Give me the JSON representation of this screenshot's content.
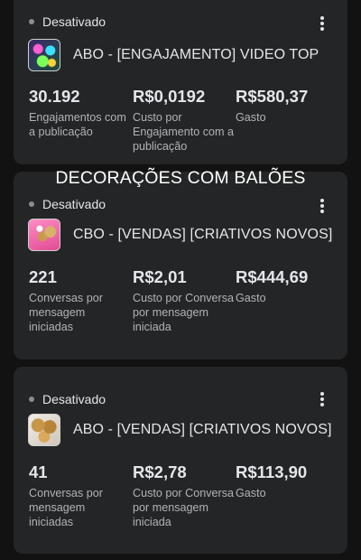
{
  "section_title": "DECORAÇÕES COM BALÕES",
  "cards": [
    {
      "status": "Desativado",
      "ad_name": "ABO - [ENGAJAMENTO] VIDEO TOP",
      "metrics": [
        {
          "value": "30.192",
          "label": "Engajamentos com a publicação"
        },
        {
          "value": "R$0,0192",
          "label": "Custo por Engajamento com a publicação"
        },
        {
          "value": "R$580,37",
          "label": "Gasto"
        }
      ]
    },
    {
      "status": "Desativado",
      "ad_name": "CBO - [VENDAS] [CRIATIVOS NOVOS]",
      "metrics": [
        {
          "value": "221",
          "label": "Conversas por mensagem iniciadas"
        },
        {
          "value": "R$2,01",
          "label": "Custo por Conversa por mensagem iniciada"
        },
        {
          "value": "R$444,69",
          "label": "Gasto"
        }
      ]
    },
    {
      "status": "Desativado",
      "ad_name": "ABO - [VENDAS] [CRIATIVOS NOVOS]",
      "metrics": [
        {
          "value": "41",
          "label": "Conversas por mensagem iniciadas"
        },
        {
          "value": "R$2,78",
          "label": "Custo por Conversa por mensagem iniciada"
        },
        {
          "value": "R$113,90",
          "label": "Gasto"
        }
      ]
    }
  ]
}
